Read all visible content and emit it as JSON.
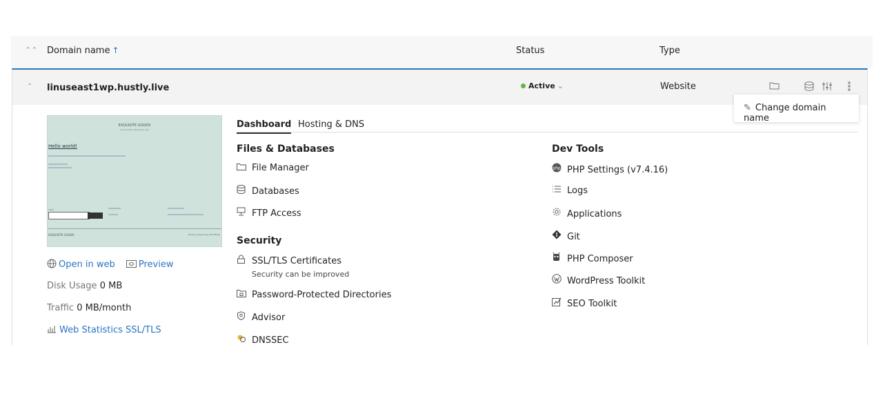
{
  "header": {
    "domain_name_label": "Domain name",
    "sort_arrow": "↑",
    "status_label": "Status",
    "type_label": "Type"
  },
  "row": {
    "domain": "linuseast1wp.hustly.live",
    "status": "Active",
    "type": "Website",
    "status_color": "#68b248"
  },
  "menu": {
    "change_domain": "Change domain name"
  },
  "preview": {
    "site_title": "EXQUISITE GOODS",
    "site_tagline": "Just another WordPress site",
    "hello": "Hello world!",
    "footer_left": "EXQUISITE GOODS",
    "footer_right": "Proudly powered by WordPress"
  },
  "left": {
    "open_web": "Open in web",
    "preview": "Preview",
    "disk_label": "Disk Usage",
    "disk_value": "0 MB",
    "traffic_label": "Traffic",
    "traffic_value": "0 MB/month",
    "web_stats": "Web Statistics SSL/TLS"
  },
  "tabs": [
    "Dashboard",
    "Hosting & DNS"
  ],
  "files_db": {
    "title": "Files & Databases",
    "items": [
      "File Manager",
      "Databases",
      "FTP Access"
    ]
  },
  "security": {
    "title": "Security",
    "ssl": "SSL/TLS Certificates",
    "ssl_note": "Security can be improved",
    "items": [
      "Password-Protected Directories",
      "Advisor",
      "DNSSEC"
    ]
  },
  "dev_tools": {
    "title": "Dev Tools",
    "items": [
      "PHP Settings (v7.4.16)",
      "Logs",
      "Applications",
      "Git",
      "PHP Composer",
      "WordPress Toolkit",
      "SEO Toolkit"
    ]
  },
  "icons": {
    "folder": "folder-icon",
    "database": "database-icon",
    "sliders": "sliders-icon",
    "more": "more-vertical-icon"
  },
  "colors": {
    "accent": "#2a73c2",
    "border_active": "#2b77b8"
  }
}
